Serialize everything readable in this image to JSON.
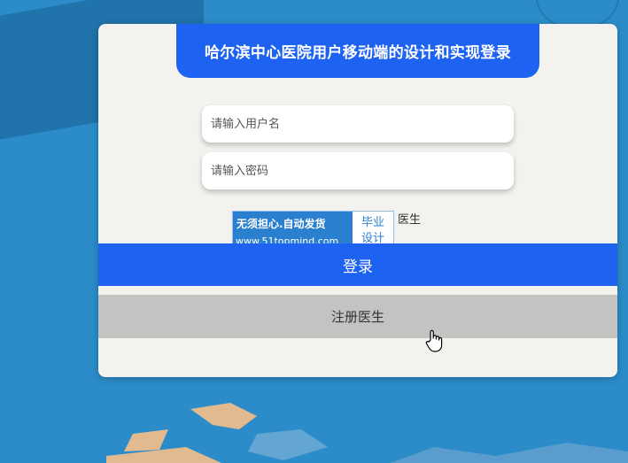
{
  "page": {
    "title": "哈尔滨中心医院用户移动端的设计和实现登录"
  },
  "form": {
    "username_placeholder": "请输入用户名",
    "password_placeholder": "请输入密码",
    "role_label": "医生"
  },
  "watermark": {
    "line1": "无须担心.自动发货",
    "line2": "www.51topmind.com",
    "box_line1": "毕业",
    "box_line2": "设计"
  },
  "buttons": {
    "login": "登录",
    "register": "注册医生"
  },
  "colors": {
    "primary": "#1e62f1",
    "background": "#2b8cc9",
    "card": "#f4f2ee",
    "register_bg": "#c4c3c1"
  },
  "icons": {
    "cursor": "hand-pointer-icon"
  }
}
